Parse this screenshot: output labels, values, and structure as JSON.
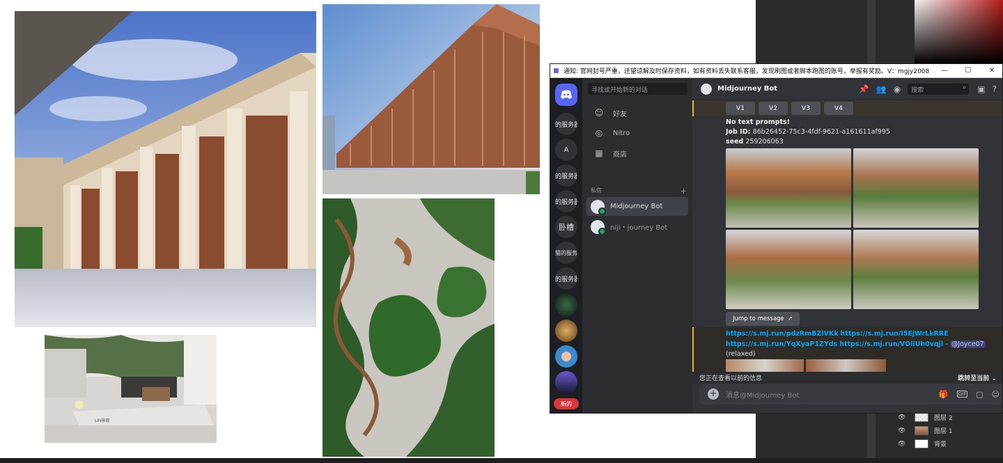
{
  "colors": {
    "discord_bg": "#313338",
    "sidebar": "#2b2d31",
    "servers": "#1e1f22",
    "accent": "#5865f2",
    "link": "#00a8fc",
    "highlight_border": "#f0b232",
    "danger": "#da373c"
  },
  "canvas": {
    "photos": [
      "classical-colonnade-building",
      "terracotta-fin-facade-building",
      "serpentine-garden-aerial",
      "minimal-courtyard-garden"
    ],
    "courtyard_caption": "LIN景观"
  },
  "window": {
    "notice": "通知: 官网封号严重，还望谅解及时保存资料，如有资料丢失联系客服，发现刷图或者脚本跑图的账号，举报有奖励。V：mgjy2008",
    "minimize": "—",
    "maximize": "☐",
    "close": "✕"
  },
  "servers": {
    "items": [
      {
        "label": "的服务器"
      },
      {
        "label": "A"
      },
      {
        "label": "的服务器"
      },
      {
        "label": "的服务器"
      },
      {
        "label": "卧槽"
      },
      {
        "label": "猫的服务器"
      },
      {
        "label": "的服务器"
      }
    ],
    "new_badge": "新的"
  },
  "dm": {
    "search_placeholder": "寻找或开始新的对话",
    "nav": [
      {
        "label": "好友",
        "icon": "friends-icon"
      },
      {
        "label": "Nitro",
        "icon": "nitro-icon"
      },
      {
        "label": "商店",
        "icon": "shop-icon"
      }
    ],
    "section_label": "私信",
    "add": "+",
    "items": [
      {
        "name": "Midjourney Bot"
      },
      {
        "name": "niji・journey Bot"
      }
    ]
  },
  "chat": {
    "title": "Midjourney Bot",
    "search_placeholder": "搜索",
    "variation_buttons": [
      "V1",
      "V2",
      "V3",
      "V4"
    ],
    "line1": "No text prompts!",
    "job_label": "Job ID",
    "job_id": "86b26452-75c3-4fdf-9621-a161611af995",
    "seed_label": "seed",
    "seed": "259206063",
    "jump_label": "Jump to message",
    "links1a": "https://s.mj.run/pdzRmBZlVKk",
    "links1b": "https://s.mj.run/I5EjWrLkRRE",
    "links2a": "https://s.mj.run/YqXyaP1ZYds",
    "links2b": "https://s.mj.run/VOliUh0vqjl",
    "dash": "-",
    "mention": "@Joyce07",
    "status": "(relaxed)",
    "old_notice": "您正在查看以前的信息",
    "jump_present": "跳转至当前",
    "composer_placeholder": "消息@Midjourney Bot",
    "gif": "GIF"
  },
  "ps_layers": [
    {
      "name": "图层 2"
    },
    {
      "name": "图层 1"
    },
    {
      "name": "背景"
    }
  ]
}
